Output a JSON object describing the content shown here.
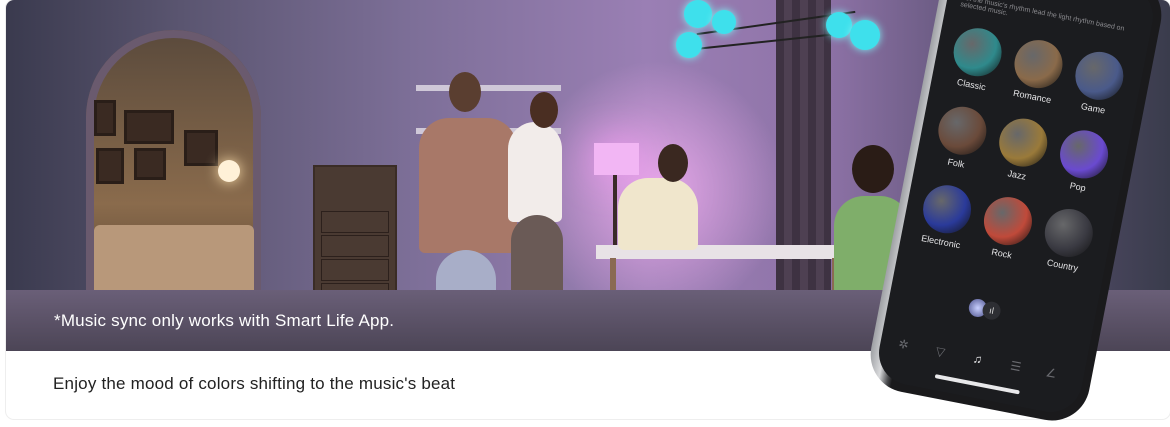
{
  "banner": {
    "disclaimer": "*Music sync only works with Smart Life App.",
    "caption": "Enjoy the mood of colors shifting to the music's beat"
  },
  "phone": {
    "hint_text": "Let the music's rhythm lead the light rhythm based on selected music.",
    "genres": [
      {
        "label": "Classic",
        "color": "#2f8a8c"
      },
      {
        "label": "Romance",
        "color": "#8a6a4a"
      },
      {
        "label": "Game",
        "color": "#4a5a8a"
      },
      {
        "label": "Folk",
        "color": "#6a4a3a"
      },
      {
        "label": "Jazz",
        "color": "#9a7a3a"
      },
      {
        "label": "Pop",
        "color": "#6a4ad0"
      },
      {
        "label": "Electronic",
        "color": "#2a3a9a"
      },
      {
        "label": "Rock",
        "color": "#c04a3a"
      },
      {
        "label": "Country",
        "color": "#3a3a42"
      }
    ],
    "tabs": [
      {
        "icon": "settings-icon",
        "glyph": "✲"
      },
      {
        "icon": "scene-icon",
        "glyph": "▽"
      },
      {
        "icon": "music-icon",
        "glyph": "♫"
      },
      {
        "icon": "list-icon",
        "glyph": "☰"
      },
      {
        "icon": "edit-icon",
        "glyph": "∠"
      }
    ]
  },
  "colors": {
    "accent_lamp": "#f2b6f4",
    "orb": "#3ee0ec"
  }
}
